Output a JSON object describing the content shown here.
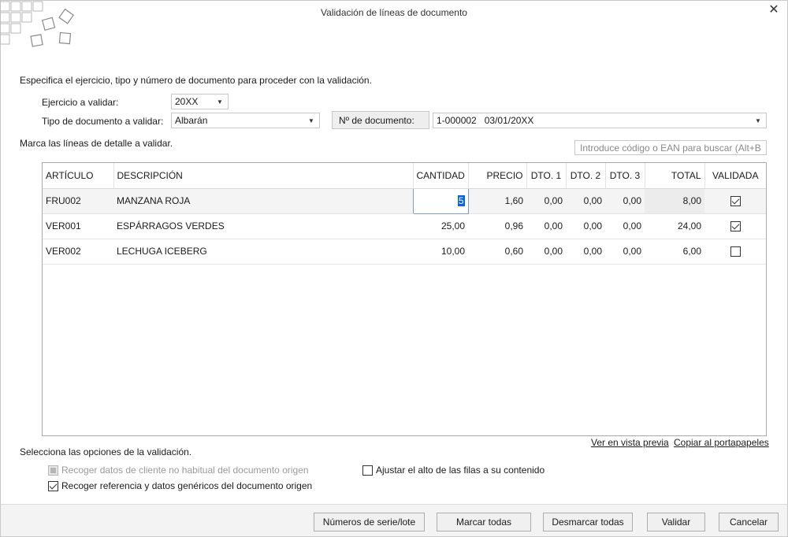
{
  "window": {
    "title": "Validación de líneas de documento"
  },
  "intro": "Especifica el ejercicio, tipo y número de documento para proceder con la validación.",
  "ejercicio": {
    "label": "Ejercicio a validar:",
    "value": "20XX"
  },
  "tipo": {
    "label": "Tipo de documento a validar:",
    "value": "Albarán"
  },
  "documento": {
    "label": "Nº de documento:",
    "value": "1-000002   03/01/20XX"
  },
  "lines_label": "Marca las líneas de detalle a validar.",
  "search": {
    "placeholder": "Introduce código o EAN para buscar (Alt+B)"
  },
  "grid": {
    "columns": [
      "ARTÍCULO",
      "DESCRIPCIÓN",
      "CANTIDAD",
      "PRECIO",
      "DTO. 1",
      "DTO. 2",
      "DTO. 3",
      "TOTAL",
      "VALIDADA"
    ],
    "rows": [
      {
        "articulo": "FRU002",
        "descripcion": "MANZANA ROJA",
        "cantidad": "5",
        "precio": "1,60",
        "dto1": "0,00",
        "dto2": "0,00",
        "dto3": "0,00",
        "total": "8,00",
        "validada": true
      },
      {
        "articulo": "VER001",
        "descripcion": "ESPÁRRAGOS VERDES",
        "cantidad": "25,00",
        "precio": "0,96",
        "dto1": "0,00",
        "dto2": "0,00",
        "dto3": "0,00",
        "total": "24,00",
        "validada": true
      },
      {
        "articulo": "VER002",
        "descripcion": "LECHUGA ICEBERG",
        "cantidad": "10,00",
        "precio": "0,60",
        "dto1": "0,00",
        "dto2": "0,00",
        "dto3": "0,00",
        "total": "6,00",
        "validada": false
      }
    ]
  },
  "links": {
    "preview": "Ver en vista previa",
    "copy": "Copiar al portapapeles"
  },
  "options": {
    "label": "Selecciona las opciones de la validación.",
    "recoger_cliente": {
      "label": "Recoger datos de cliente no habitual del documento origen",
      "checked": true,
      "disabled": true
    },
    "recoger_referencia": {
      "label": "Recoger referencia y datos genéricos del documento origen",
      "checked": true
    },
    "ajustar_alto": {
      "label": "Ajustar el alto de las filas a su contenido",
      "checked": false
    }
  },
  "buttons": {
    "serie": "Números de serie/lote",
    "marcar": "Marcar todas",
    "desmarcar": "Desmarcar todas",
    "validar": "Validar",
    "cancelar": "Cancelar"
  },
  "icons": {
    "close": "close-icon",
    "dropdown": "chevron-down-icon",
    "logo": "logo-icon"
  }
}
